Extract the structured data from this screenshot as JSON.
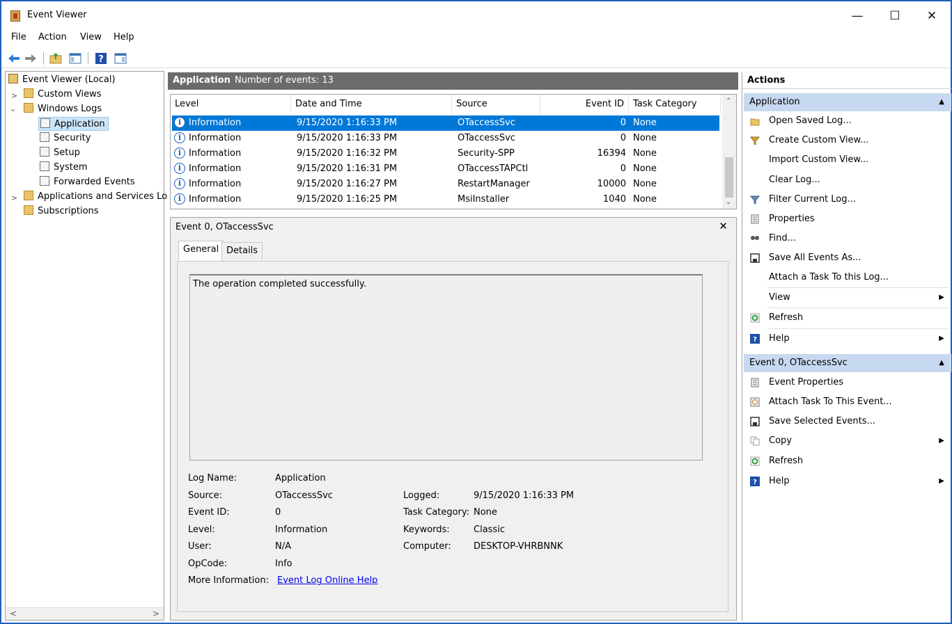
{
  "window": {
    "title": "Event Viewer",
    "minimize": "—",
    "maximize": "☐",
    "close": "✕"
  },
  "menu": [
    "File",
    "Action",
    "View",
    "Help"
  ],
  "tree": {
    "root": "Event Viewer (Local)",
    "custom_views": "Custom Views",
    "windows_logs": "Windows Logs",
    "application": "Application",
    "security": "Security",
    "setup": "Setup",
    "system": "System",
    "forwarded": "Forwarded Events",
    "apps_services": "Applications and Services Lo",
    "subscriptions": "Subscriptions"
  },
  "log_header": {
    "name": "Application",
    "count_text": "Number of events: 13"
  },
  "columns": [
    "Level",
    "Date and Time",
    "Source",
    "Event ID",
    "Task Category"
  ],
  "events": [
    {
      "level": "Information",
      "datetime": "9/15/2020 1:16:33 PM",
      "source": "OTaccessSvc",
      "event_id": "0",
      "category": "None"
    },
    {
      "level": "Information",
      "datetime": "9/15/2020 1:16:33 PM",
      "source": "OTaccessSvc",
      "event_id": "0",
      "category": "None"
    },
    {
      "level": "Information",
      "datetime": "9/15/2020 1:16:32 PM",
      "source": "Security-SPP",
      "event_id": "16394",
      "category": "None"
    },
    {
      "level": "Information",
      "datetime": "9/15/2020 1:16:31 PM",
      "source": "OTaccessTAPCtl",
      "event_id": "0",
      "category": "None"
    },
    {
      "level": "Information",
      "datetime": "9/15/2020 1:16:27 PM",
      "source": "RestartManager",
      "event_id": "10000",
      "category": "None"
    },
    {
      "level": "Information",
      "datetime": "9/15/2020 1:16:25 PM",
      "source": "MsiInstaller",
      "event_id": "1040",
      "category": "None"
    }
  ],
  "detail": {
    "title": "Event 0, OTaccessSvc",
    "tabs": [
      "General",
      "Details"
    ],
    "description": "The operation completed successfully.",
    "labels": {
      "log_name": "Log Name:",
      "source": "Source:",
      "event_id": "Event ID:",
      "level": "Level:",
      "user": "User:",
      "opcode": "OpCode:",
      "more_info": "More Information:",
      "logged": "Logged:",
      "task_category": "Task Category:",
      "keywords": "Keywords:",
      "computer": "Computer:"
    },
    "values": {
      "log_name": "Application",
      "source": "OTaccessSvc",
      "event_id": "0",
      "level": "Information",
      "user": "N/A",
      "opcode": "Info",
      "more_info_link": "Event Log Online Help",
      "logged": "9/15/2020 1:16:33 PM",
      "task_category": "None",
      "keywords": "Classic",
      "computer": "DESKTOP-VHRBNNK"
    }
  },
  "actions": {
    "header": "Actions",
    "group1": "Application",
    "items1": [
      "Open Saved Log...",
      "Create Custom View...",
      "Import Custom View...",
      "Clear Log...",
      "Filter Current Log...",
      "Properties",
      "Find...",
      "Save All Events As...",
      "Attach a Task To this Log...",
      "View",
      "Refresh",
      "Help"
    ],
    "group2": "Event 0, OTaccessSvc",
    "items2": [
      "Event Properties",
      "Attach Task To This Event...",
      "Save Selected Events...",
      "Copy",
      "Refresh",
      "Help"
    ]
  },
  "colors": {
    "accent": "#0078d7",
    "group_bg": "#c7d9f0",
    "header_bg": "#6b6b6b",
    "window_border": "#1f5fbf"
  }
}
